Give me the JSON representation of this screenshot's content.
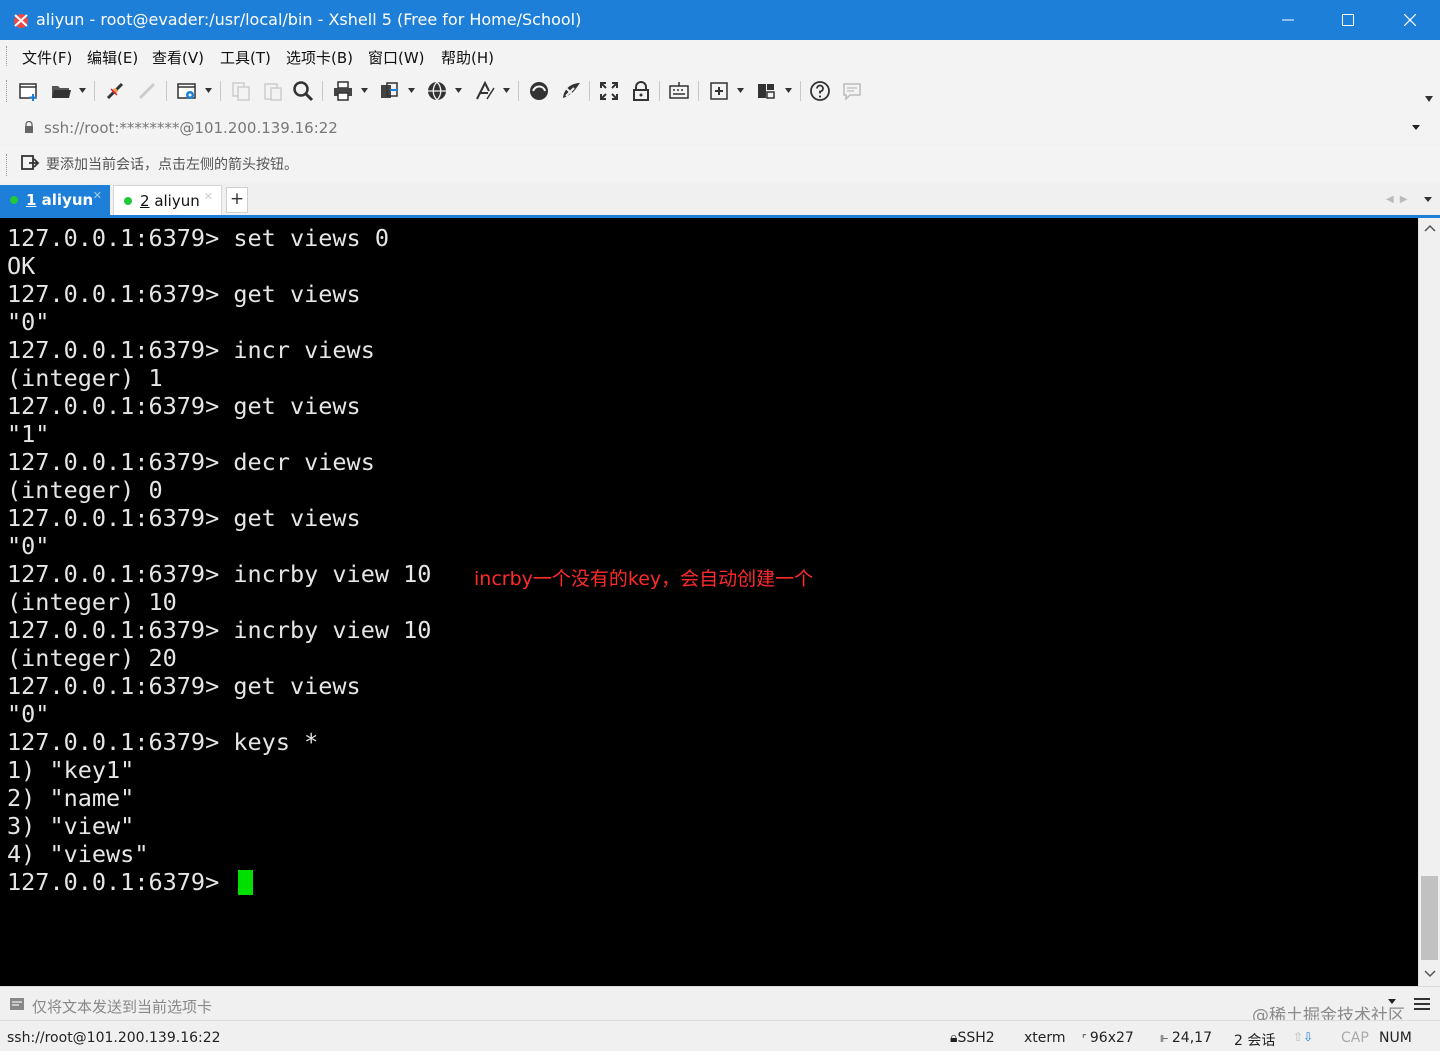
{
  "window": {
    "title": "aliyun - root@evader:/usr/local/bin - Xshell 5 (Free for Home/School)",
    "accent_color": "#1e7fd8"
  },
  "menu": [
    "文件(F)",
    "编辑(E)",
    "查看(V)",
    "工具(T)",
    "选项卡(B)",
    "窗口(W)",
    "帮助(H)"
  ],
  "toolbar_icons": [
    "new-session-icon",
    "open-folder-icon",
    "reconnect-icon",
    "disconnect-icon",
    "properties-icon",
    "copy-icon",
    "paste-icon",
    "find-icon",
    "print-icon",
    "transfer-icon",
    "globe-icon",
    "font-icon",
    "xftp-icon",
    "xmanager-icon",
    "fullscreen-icon",
    "lock-icon",
    "keyboard-icon",
    "new-window-icon",
    "layout-icon",
    "help-icon",
    "chat-icon"
  ],
  "address": {
    "url": "ssh://root:********@101.200.139.16:22"
  },
  "hint": {
    "text": "要添加当前会话，点击左侧的箭头按钮。"
  },
  "tabs": [
    {
      "number": "1",
      "label": "1 aliyun",
      "active": true
    },
    {
      "number": "2",
      "label": "2 aliyun",
      "active": false
    }
  ],
  "tab_add_label": "+",
  "terminal": {
    "lines": [
      "127.0.0.1:6379> set views 0",
      "OK",
      "127.0.0.1:6379> get views",
      "\"0\"",
      "127.0.0.1:6379> incr views",
      "(integer) 1",
      "127.0.0.1:6379> get views",
      "\"1\"",
      "127.0.0.1:6379> decr views",
      "(integer) 0",
      "127.0.0.1:6379> get views",
      "\"0\"",
      "127.0.0.1:6379> incrby view 10",
      "(integer) 10",
      "127.0.0.1:6379> incrby view 10",
      "(integer) 20",
      "127.0.0.1:6379> get views",
      "\"0\"",
      "127.0.0.1:6379> keys *",
      "1) \"key1\"",
      "2) \"name\"",
      "3) \"view\"",
      "4) \"views\"",
      "127.0.0.1:6379> "
    ],
    "annotation": "incrby一个没有的key，会自动创建一个",
    "annotation_color": "#ff2a2a",
    "cursor_color": "#00e000"
  },
  "compose": {
    "text": "仅将文本发送到当前选项卡"
  },
  "watermark": "@稀土掘金技术社区",
  "status": {
    "connection": "ssh://root@101.200.139.16:22",
    "protocol": "SSH2",
    "terminal_type": "xterm",
    "size": "96x27",
    "position": "24,17",
    "sessions": "2 会话",
    "cap": "CAP",
    "num": "NUM"
  }
}
